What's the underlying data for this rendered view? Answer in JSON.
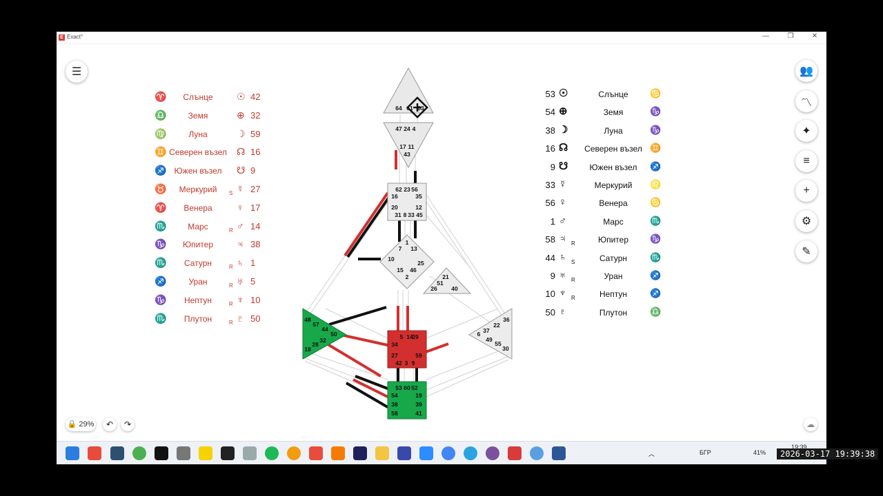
{
  "window": {
    "title": "Exact°",
    "minimize": "—",
    "maximize": "❐",
    "close": "✕"
  },
  "left_panel": [
    {
      "sign": "♈",
      "label": "Слънце",
      "glyph": "☉",
      "sub": "",
      "value": "42"
    },
    {
      "sign": "♎",
      "label": "Земя",
      "glyph": "⊕",
      "sub": "",
      "value": "32"
    },
    {
      "sign": "♍",
      "label": "Луна",
      "glyph": "☽",
      "sub": "",
      "value": "59"
    },
    {
      "sign": "♊",
      "label": "Северен възел",
      "glyph": "☊",
      "sub": "",
      "value": "16"
    },
    {
      "sign": "♐",
      "label": "Южен възел",
      "glyph": "☋",
      "sub": "",
      "value": "9"
    },
    {
      "sign": "♉",
      "label": "Меркурий",
      "glyph": "☿",
      "sub": "S",
      "value": "27"
    },
    {
      "sign": "♈",
      "label": "Венера",
      "glyph": "♀",
      "sub": "",
      "value": "17"
    },
    {
      "sign": "♏",
      "label": "Марс",
      "glyph": "♂",
      "sub": "R",
      "value": "14"
    },
    {
      "sign": "♑",
      "label": "Юпитер",
      "glyph": "♃",
      "sub": "",
      "value": "38"
    },
    {
      "sign": "♏",
      "label": "Сатурн",
      "glyph": "♄",
      "sub": "R",
      "value": "1"
    },
    {
      "sign": "♐",
      "label": "Уран",
      "glyph": "♅",
      "sub": "R",
      "value": "5"
    },
    {
      "sign": "♑",
      "label": "Нептун",
      "glyph": "♆",
      "sub": "R",
      "value": "10"
    },
    {
      "sign": "♏",
      "label": "Плутон",
      "glyph": "♇",
      "sub": "R",
      "value": "50"
    }
  ],
  "right_panel": [
    {
      "value": "53",
      "glyph": "☉",
      "sub": "",
      "label": "Слънце",
      "sign": "♋",
      "sign_color": "#3a7bd5"
    },
    {
      "value": "54",
      "glyph": "⊕",
      "sub": "",
      "label": "Земя",
      "sign": "♑",
      "sign_color": "#c98a1c"
    },
    {
      "value": "38",
      "glyph": "☽",
      "sub": "",
      "label": "Луна",
      "sign": "♑",
      "sign_color": "#c98a1c"
    },
    {
      "value": "16",
      "glyph": "☊",
      "sub": "",
      "label": "Северен възел",
      "sign": "♊",
      "sign_color": "#7aa6e0"
    },
    {
      "value": "9",
      "glyph": "☋",
      "sub": "",
      "label": "Южен възел",
      "sign": "♐",
      "sign_color": "#e05050"
    },
    {
      "value": "33",
      "glyph": "☿",
      "sub": "",
      "label": "Меркурий",
      "sign": "♌",
      "sign_color": "#e05050"
    },
    {
      "value": "56",
      "glyph": "♀",
      "sub": "",
      "label": "Венера",
      "sign": "♋",
      "sign_color": "#3a7bd5"
    },
    {
      "value": "1",
      "glyph": "♂",
      "sub": "",
      "label": "Марс",
      "sign": "♏",
      "sign_color": "#3a7bd5"
    },
    {
      "value": "58",
      "glyph": "♃",
      "sub": "R",
      "label": "Юпитер",
      "sign": "♑",
      "sign_color": "#c98a1c"
    },
    {
      "value": "44",
      "glyph": "♄",
      "sub": "S",
      "label": "Сатурн",
      "sign": "♏",
      "sign_color": "#3a7bd5"
    },
    {
      "value": "9",
      "glyph": "♅",
      "sub": "R",
      "label": "Уран",
      "sign": "♐",
      "sign_color": "#e05050"
    },
    {
      "value": "10",
      "glyph": "♆",
      "sub": "R",
      "label": "Нептун",
      "sign": "♐",
      "sign_color": "#e05050"
    },
    {
      "value": "50",
      "glyph": "♇",
      "sub": "",
      "label": "Плутон",
      "sign": "♎",
      "sign_color": "#3a7bd5"
    }
  ],
  "centers": {
    "head": [
      "64",
      "61",
      "63"
    ],
    "ajna": [
      "47",
      "24",
      "4",
      "17",
      "11",
      "43"
    ],
    "throat": [
      "62",
      "23",
      "56",
      "16",
      "35",
      "20",
      "12",
      "31",
      "8",
      "33",
      "45"
    ],
    "g": [
      "1",
      "7",
      "13",
      "10",
      "25",
      "15",
      "46",
      "2"
    ],
    "heart": [
      "21",
      "51",
      "26",
      "40"
    ],
    "spleen": [
      "48",
      "57",
      "44",
      "50",
      "32",
      "28",
      "18"
    ],
    "sacral": [
      "5",
      "14",
      "29",
      "34",
      "27",
      "59",
      "42",
      "3",
      "9"
    ],
    "solar": [
      "6",
      "37",
      "22",
      "36",
      "49",
      "55",
      "30"
    ],
    "root": [
      "53",
      "60",
      "52",
      "54",
      "19",
      "38",
      "39",
      "58",
      "41"
    ]
  },
  "colors": {
    "defined_red": "#d32f2f",
    "defined_green": "#17a84a",
    "undefined": "#ececec",
    "accent_red": "#c0392b"
  },
  "zoom": {
    "level": "29%"
  },
  "toolbar_right": [
    "people-icon",
    "chart-line-icon",
    "sparkle-icon",
    "list-icon",
    "plus-icon",
    "gear-icon",
    "pencil-icon"
  ],
  "taskbar": {
    "lang": "БГР",
    "battery": "41%",
    "time": "19:39",
    "date": "17"
  },
  "overlay_clock": "2026-03-17 19:39:38"
}
